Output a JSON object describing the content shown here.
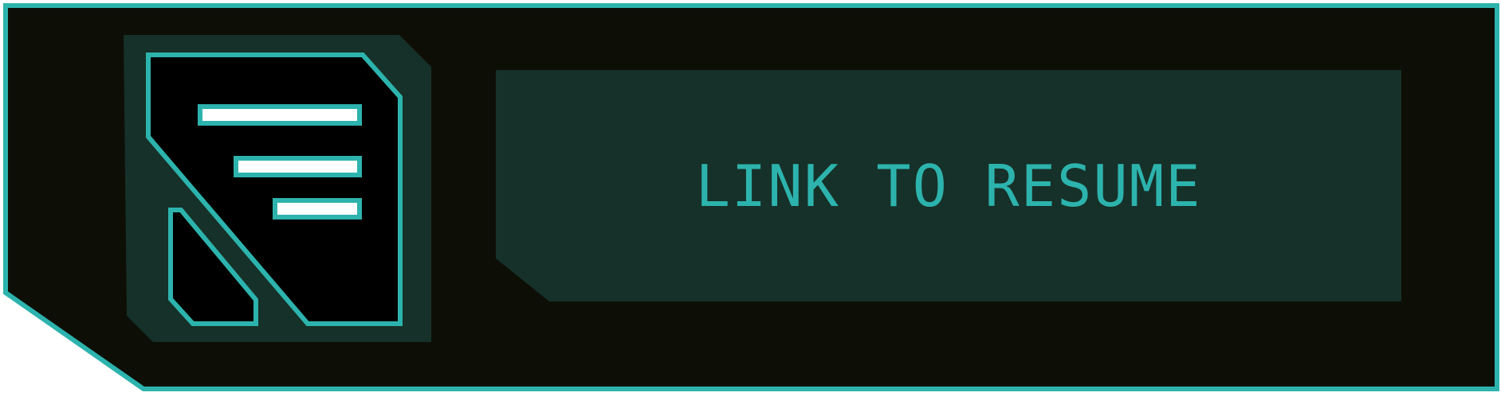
{
  "link": {
    "label": "LINK TO RESUME"
  },
  "icon": {
    "name": "document-icon"
  },
  "colors": {
    "accent": "#2db3ad",
    "background": "#0d0f07",
    "panel": "#163129",
    "document_fill": "#000000",
    "line_fill": "#ffffff"
  }
}
